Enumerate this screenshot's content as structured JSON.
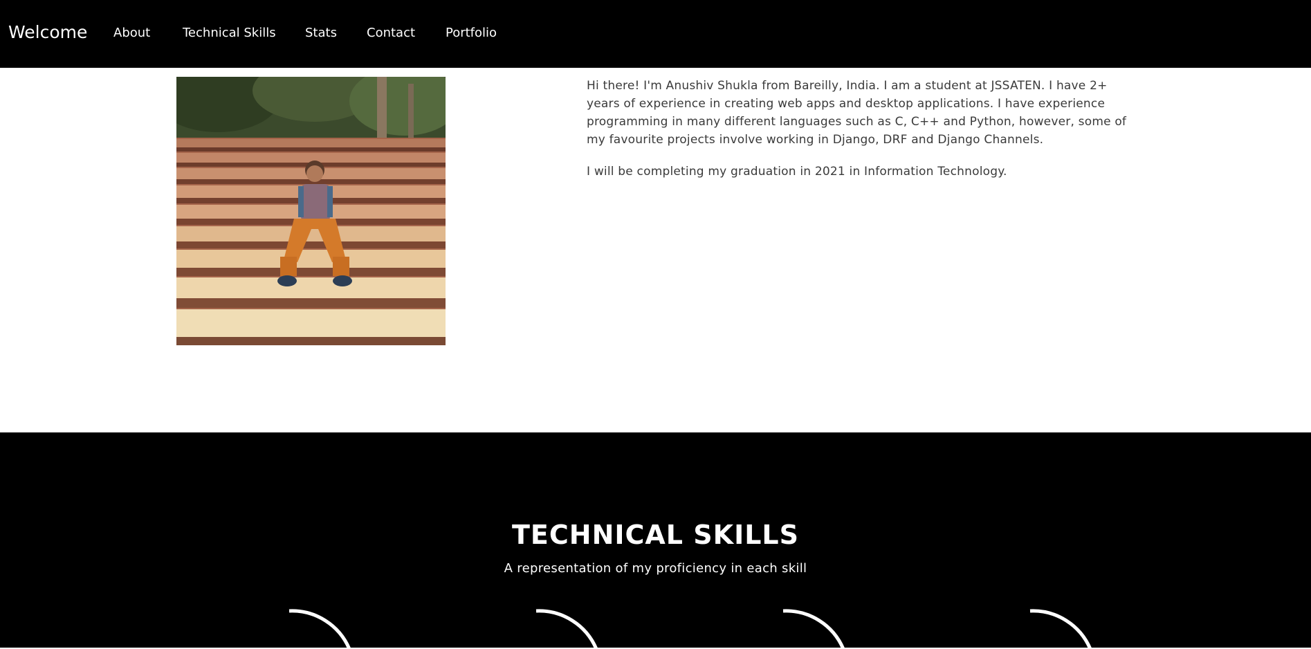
{
  "navbar": {
    "brand": "Welcome",
    "links": [
      "About",
      "Technical Skills",
      "Stats",
      "Contact",
      "Portfolio"
    ]
  },
  "about": {
    "paragraph1": "Hi there! I'm Anushiv Shukla from Bareilly, India. I am a student at JSSATEN. I have 2+ years of experience in creating web apps and desktop applications. I have experience programming in many different languages such as C, C++ and Python, however, some of my favourite projects involve working in Django, DRF and Django Channels.",
    "paragraph2": "I will be completing my graduation in 2021 in Information Technology."
  },
  "skills": {
    "title": "TECHNICAL SKILLS",
    "subtitle": "A representation of my proficiency in each skill",
    "gauge_count": 4
  },
  "colors": {
    "navbar_bg": "#000000",
    "section_bg": "#000000",
    "text_light": "#ffffff",
    "text_body": "#3a3a3a"
  }
}
